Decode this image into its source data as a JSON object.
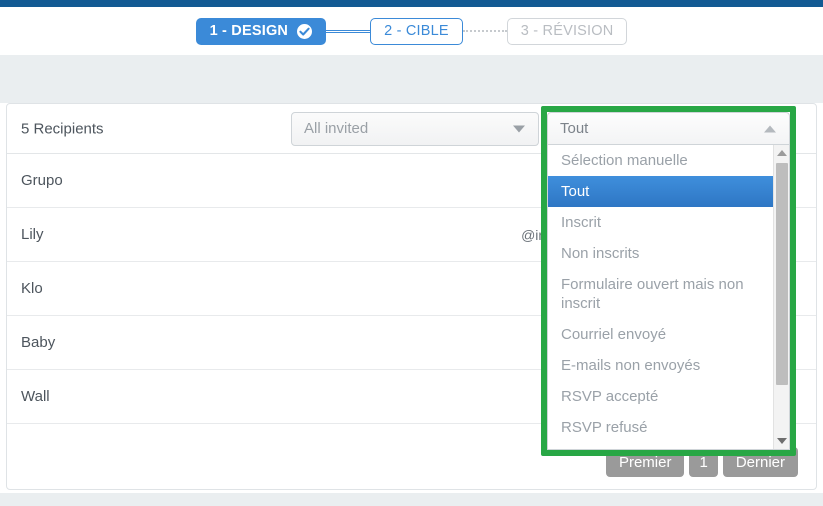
{
  "theme": {
    "topbar_color": "#135a93",
    "accent_blue": "#3b8ad8",
    "highlight_green": "#28a745",
    "band_gray": "#eaeef0",
    "pager_gray": "#9a9a9a"
  },
  "stepper": {
    "steps": [
      {
        "label": "1 - DESIGN",
        "state": "done",
        "icon": "check-circle-icon"
      },
      {
        "label": "2 - CIBLE",
        "state": "current"
      },
      {
        "label": "3 - RÉVISION",
        "state": "todo"
      }
    ]
  },
  "card": {
    "header": {
      "recipients_label": "5 Recipients",
      "invited_select": {
        "value": "All invited",
        "icon": "chevron-down-icon"
      }
    },
    "rows": [
      {
        "name": "Grupo",
        "email": ""
      },
      {
        "name": "Lily",
        "email": "@ine"
      },
      {
        "name": "Klo",
        "email": ""
      },
      {
        "name": "Baby",
        "email": ""
      },
      {
        "name": "Wall",
        "email": ""
      }
    ],
    "pager": {
      "first": "Premier",
      "page": "1",
      "last": "Dernier"
    }
  },
  "dropdown": {
    "selected_value": "Tout",
    "toggle_icon": "chevron-up-icon",
    "scrollbar": {
      "up_icon": "scroll-up-arrow-icon",
      "down_icon": "scroll-down-arrow-icon"
    },
    "options": [
      {
        "label": "Sélection manuelle",
        "selected": false
      },
      {
        "label": "Tout",
        "selected": true
      },
      {
        "label": "Inscrit",
        "selected": false
      },
      {
        "label": "Non inscrits",
        "selected": false
      },
      {
        "label": "Formulaire ouvert mais non inscrit",
        "selected": false
      },
      {
        "label": "Courriel envoyé",
        "selected": false
      },
      {
        "label": "E-mails non envoyés",
        "selected": false
      },
      {
        "label": "RSVP accepté",
        "selected": false
      },
      {
        "label": "RSVP refusé",
        "selected": false
      }
    ]
  }
}
